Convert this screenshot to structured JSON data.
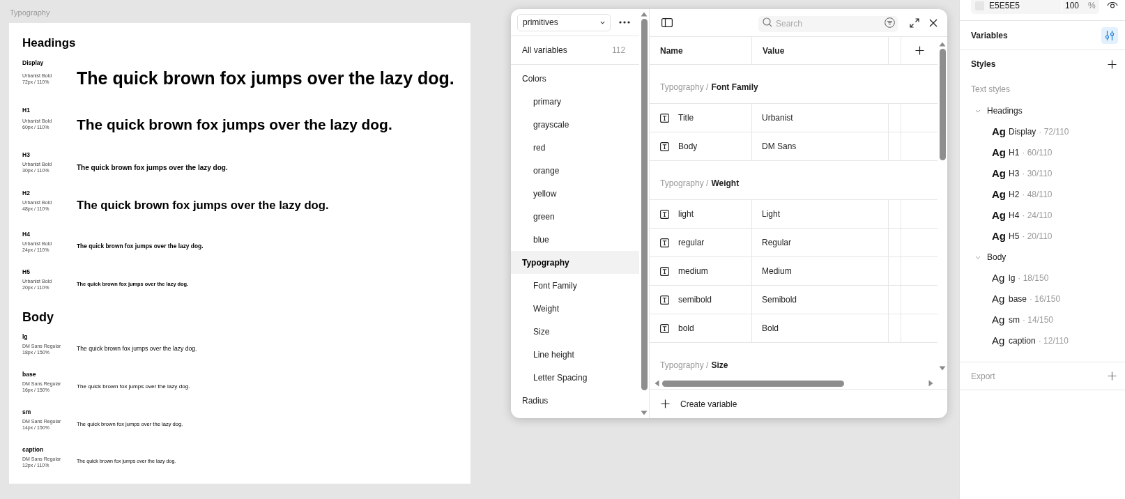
{
  "canvas": {
    "frame_label": "Typography",
    "sections": [
      {
        "title": "Headings",
        "kind": "heading",
        "styles": [
          {
            "name": "Display",
            "font": "Urbanist Bold",
            "metrics": "72px / 110%",
            "sample": "The quick brown fox jumps over the lazy dog."
          },
          {
            "name": "H1",
            "font": "Urbanist Bold",
            "metrics": "60px / 110%",
            "sample": "The quick brown fox jumps over the lazy dog."
          },
          {
            "name": "H3",
            "font": "Urbanist Bold",
            "metrics": "30px / 110%",
            "sample": "The quick brown fox jumps over the lazy dog."
          },
          {
            "name": "H2",
            "font": "Urbanist Bold",
            "metrics": "48px / 110%",
            "sample": "The quick brown fox jumps over the lazy dog."
          },
          {
            "name": "H4",
            "font": "Urbanist Bold",
            "metrics": "24px / 110%",
            "sample": "The quick brown fox jumps over the lazy dog."
          },
          {
            "name": "H5",
            "font": "Urbanist Bold",
            "metrics": "20px / 110%",
            "sample": "The quick brown fox jumps over the lazy dog."
          }
        ]
      },
      {
        "title": "Body",
        "kind": "body",
        "styles": [
          {
            "name": "lg",
            "font": "DM Sans Regular",
            "metrics": "18px / 150%",
            "sample": "The quick brown fox jumps over the lazy dog."
          },
          {
            "name": "base",
            "font": "DM Sans Regular",
            "metrics": "16px / 150%",
            "sample": "The quick brown fox jumps over the lazy dog."
          },
          {
            "name": "sm",
            "font": "DM Sans Regular",
            "metrics": "14px / 150%",
            "sample": "The quick brown fox jumps over the lazy dog."
          },
          {
            "name": "caption",
            "font": "DM Sans Regular",
            "metrics": "12px / 110%",
            "sample": "The quick brown fox jumps over the lazy dog."
          }
        ]
      }
    ]
  },
  "variables_panel": {
    "collection": "primitives",
    "all_variables": {
      "label": "All variables",
      "count": "112",
      "selected": false
    },
    "groups": [
      {
        "label": "Colors",
        "selected": false,
        "children": [
          {
            "label": "primary",
            "selected": false
          },
          {
            "label": "grayscale",
            "selected": false
          },
          {
            "label": "red",
            "selected": false
          },
          {
            "label": "orange",
            "selected": false
          },
          {
            "label": "yellow",
            "selected": false
          },
          {
            "label": "green",
            "selected": false
          },
          {
            "label": "blue",
            "selected": false
          }
        ]
      },
      {
        "label": "Typography",
        "selected": true,
        "children": [
          {
            "label": "Font Family",
            "selected": false
          },
          {
            "label": "Weight",
            "selected": false
          },
          {
            "label": "Size",
            "selected": false
          },
          {
            "label": "Line height",
            "selected": false
          },
          {
            "label": "Letter Spacing",
            "selected": false
          }
        ]
      },
      {
        "label": "Radius",
        "selected": false
      }
    ],
    "search": {
      "placeholder": "Search"
    },
    "columns": [
      "Name",
      "Value"
    ],
    "sections": [
      {
        "path": "Typography /",
        "group": "Font Family",
        "rows": [
          {
            "name": "Title",
            "value": "Urbanist"
          },
          {
            "name": "Body",
            "value": "DM Sans"
          }
        ]
      },
      {
        "path": "Typography /",
        "group": "Weight",
        "rows": [
          {
            "name": "light",
            "value": "Light"
          },
          {
            "name": "regular",
            "value": "Regular"
          },
          {
            "name": "medium",
            "value": "Medium"
          },
          {
            "name": "semibold",
            "value": "Semibold"
          },
          {
            "name": "bold",
            "value": "Bold"
          }
        ]
      },
      {
        "path": "Typography /",
        "group": "Size"
      }
    ],
    "create_label": "Create variable"
  },
  "right_panel": {
    "fill": {
      "hex": "E5E5E5",
      "opacity": "100",
      "unit": "%"
    },
    "variables_label": "Variables",
    "styles_label": "Styles",
    "text_styles_label": "Text styles",
    "style_groups": [
      {
        "label": "Headings",
        "kind": "heading",
        "expanded": true,
        "children": [
          {
            "preview": "Ag",
            "name": "Display",
            "spec": "· 72/110"
          },
          {
            "preview": "Ag",
            "name": "H1",
            "spec": "· 60/110"
          },
          {
            "preview": "Ag",
            "name": "H3",
            "spec": "· 30/110"
          },
          {
            "preview": "Ag",
            "name": "H2",
            "spec": "· 48/110"
          },
          {
            "preview": "Ag",
            "name": "H4",
            "spec": "· 24/110"
          },
          {
            "preview": "Ag",
            "name": "H5",
            "spec": "· 20/110"
          }
        ]
      },
      {
        "label": "Body",
        "kind": "body",
        "expanded": true,
        "children": [
          {
            "preview": "Ag",
            "name": "lg",
            "spec": "· 18/150"
          },
          {
            "preview": "Ag",
            "name": "base",
            "spec": "· 16/150"
          },
          {
            "preview": "Ag",
            "name": "sm",
            "spec": "· 14/150"
          },
          {
            "preview": "Ag",
            "name": "caption",
            "spec": "· 12/110"
          }
        ]
      }
    ],
    "export_label": "Export"
  }
}
